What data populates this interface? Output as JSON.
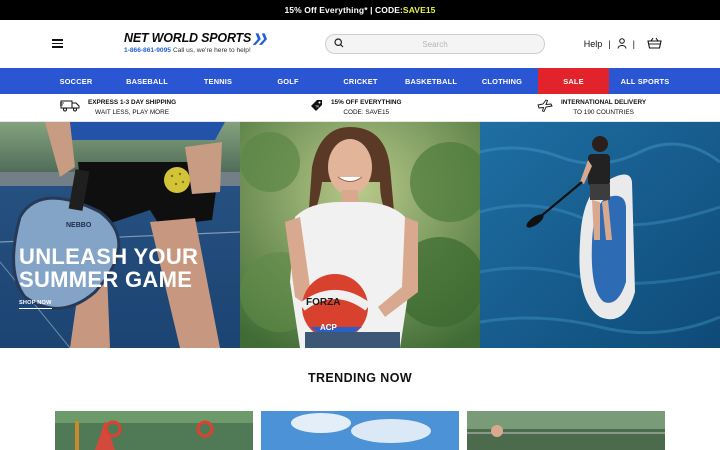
{
  "promo": {
    "main": "15% Off Everything* | CODE: ",
    "code": "SAVE15"
  },
  "header": {
    "logo_text": "NET WORLD SPORTS",
    "phone": "1-866-861-9095",
    "tagline": "Call us, we're here to help!",
    "search_placeholder": "Search",
    "help_label": "Help",
    "sep": "|"
  },
  "nav": {
    "items": [
      {
        "label": "SOCCER"
      },
      {
        "label": "BASEBALL"
      },
      {
        "label": "TENNIS"
      },
      {
        "label": "GOLF"
      },
      {
        "label": "CRICKET"
      },
      {
        "label": "BASKETBALL"
      },
      {
        "label": "CLOTHING"
      },
      {
        "label": "SALE"
      },
      {
        "label": "ALL SPORTS"
      }
    ]
  },
  "usp": [
    {
      "title": "EXPRESS 1-3 DAY SHIPPING",
      "sub": "WAIT LESS, PLAY MORE",
      "icon": "truck-icon"
    },
    {
      "title": "15% OFF EVERYTHING",
      "sub": "CODE: SAVE15",
      "icon": "tag-icon"
    },
    {
      "title": "INTERNATIONAL DELIVERY",
      "sub": "TO 190 COUNTRIES",
      "icon": "plane-icon"
    }
  ],
  "hero": {
    "headline_line1": "UNLEASH YOUR",
    "headline_line2": "SUMMER GAME",
    "cta": "SHOP NOW",
    "ball_brand": "FORZA",
    "ball_model": "ACP",
    "paddle_brand": "NEBBO"
  },
  "trending": {
    "title": "TRENDING NOW"
  },
  "colors": {
    "nav_blue": "#2a56d4",
    "sale_red": "#e3232b",
    "promo_code": "#e6f24a",
    "logo_blue": "#1f5fd6"
  }
}
